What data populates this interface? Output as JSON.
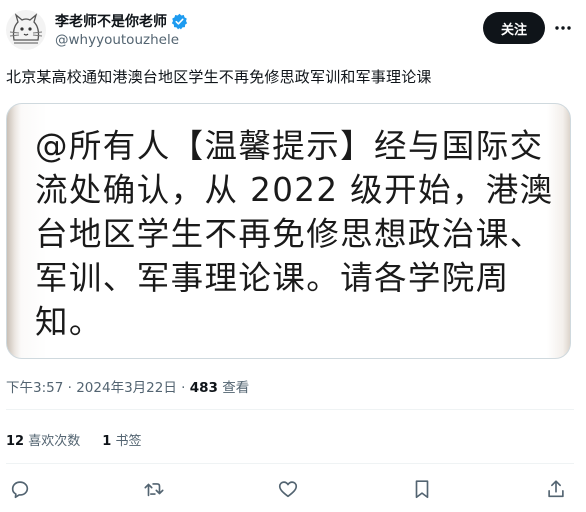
{
  "author": {
    "display_name": "李老师不是你老师",
    "handle": "@whyyoutouzhele",
    "verified": true,
    "avatar_icon": "cat-sketch-avatar-icon"
  },
  "follow_label": "关注",
  "tweet_text": "北京某高校通知港澳台地区学生不再免修思政军训和军事理论课",
  "media_text": "@所有人【温馨提示】经与国际交流处确认，从 2022 级开始，港澳台地区学生不再免修思想政治课、军训、军事理论课。请各学院周知。",
  "meta": {
    "time": "下午3:57",
    "date": "2024年3月22日",
    "views_count": "483",
    "views_label": "查看"
  },
  "stats": {
    "likes_count": "12",
    "likes_label": "喜欢次数",
    "bookmarks_count": "1",
    "bookmarks_label": "书签"
  },
  "actions": [
    "reply-icon",
    "retweet-icon",
    "like-icon",
    "bookmark-icon",
    "share-icon"
  ],
  "colors": {
    "text": "#0f1419",
    "secondary": "#536471",
    "verified": "#1d9bf0",
    "button_bg": "#0f1419",
    "border": "#cfd9de"
  }
}
